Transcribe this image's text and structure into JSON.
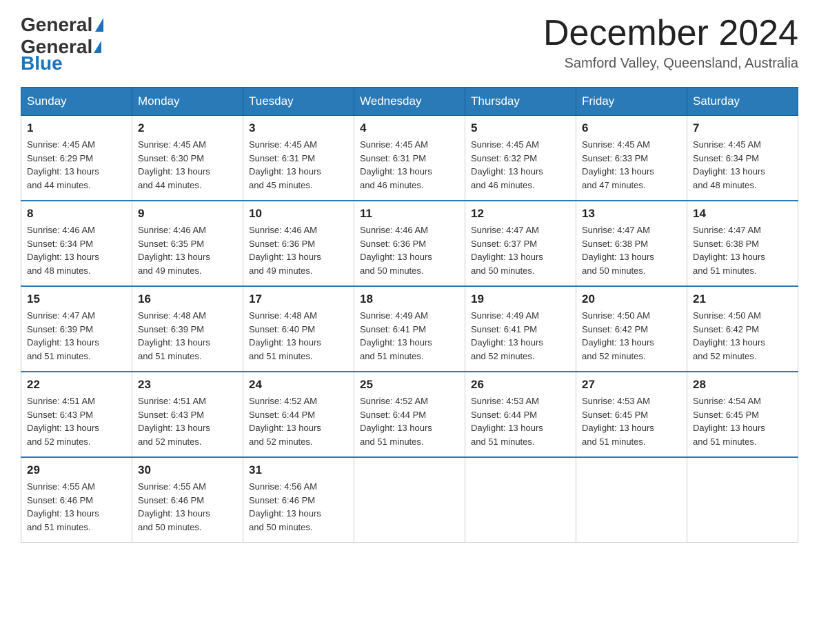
{
  "header": {
    "logo_general": "General",
    "logo_blue": "Blue",
    "month_title": "December 2024",
    "subtitle": "Samford Valley, Queensland, Australia"
  },
  "weekdays": [
    "Sunday",
    "Monday",
    "Tuesday",
    "Wednesday",
    "Thursday",
    "Friday",
    "Saturday"
  ],
  "weeks": [
    [
      {
        "day": "1",
        "sunrise": "4:45 AM",
        "sunset": "6:29 PM",
        "daylight": "13 hours and 44 minutes."
      },
      {
        "day": "2",
        "sunrise": "4:45 AM",
        "sunset": "6:30 PM",
        "daylight": "13 hours and 44 minutes."
      },
      {
        "day": "3",
        "sunrise": "4:45 AM",
        "sunset": "6:31 PM",
        "daylight": "13 hours and 45 minutes."
      },
      {
        "day": "4",
        "sunrise": "4:45 AM",
        "sunset": "6:31 PM",
        "daylight": "13 hours and 46 minutes."
      },
      {
        "day": "5",
        "sunrise": "4:45 AM",
        "sunset": "6:32 PM",
        "daylight": "13 hours and 46 minutes."
      },
      {
        "day": "6",
        "sunrise": "4:45 AM",
        "sunset": "6:33 PM",
        "daylight": "13 hours and 47 minutes."
      },
      {
        "day": "7",
        "sunrise": "4:45 AM",
        "sunset": "6:34 PM",
        "daylight": "13 hours and 48 minutes."
      }
    ],
    [
      {
        "day": "8",
        "sunrise": "4:46 AM",
        "sunset": "6:34 PM",
        "daylight": "13 hours and 48 minutes."
      },
      {
        "day": "9",
        "sunrise": "4:46 AM",
        "sunset": "6:35 PM",
        "daylight": "13 hours and 49 minutes."
      },
      {
        "day": "10",
        "sunrise": "4:46 AM",
        "sunset": "6:36 PM",
        "daylight": "13 hours and 49 minutes."
      },
      {
        "day": "11",
        "sunrise": "4:46 AM",
        "sunset": "6:36 PM",
        "daylight": "13 hours and 50 minutes."
      },
      {
        "day": "12",
        "sunrise": "4:47 AM",
        "sunset": "6:37 PM",
        "daylight": "13 hours and 50 minutes."
      },
      {
        "day": "13",
        "sunrise": "4:47 AM",
        "sunset": "6:38 PM",
        "daylight": "13 hours and 50 minutes."
      },
      {
        "day": "14",
        "sunrise": "4:47 AM",
        "sunset": "6:38 PM",
        "daylight": "13 hours and 51 minutes."
      }
    ],
    [
      {
        "day": "15",
        "sunrise": "4:47 AM",
        "sunset": "6:39 PM",
        "daylight": "13 hours and 51 minutes."
      },
      {
        "day": "16",
        "sunrise": "4:48 AM",
        "sunset": "6:39 PM",
        "daylight": "13 hours and 51 minutes."
      },
      {
        "day": "17",
        "sunrise": "4:48 AM",
        "sunset": "6:40 PM",
        "daylight": "13 hours and 51 minutes."
      },
      {
        "day": "18",
        "sunrise": "4:49 AM",
        "sunset": "6:41 PM",
        "daylight": "13 hours and 51 minutes."
      },
      {
        "day": "19",
        "sunrise": "4:49 AM",
        "sunset": "6:41 PM",
        "daylight": "13 hours and 52 minutes."
      },
      {
        "day": "20",
        "sunrise": "4:50 AM",
        "sunset": "6:42 PM",
        "daylight": "13 hours and 52 minutes."
      },
      {
        "day": "21",
        "sunrise": "4:50 AM",
        "sunset": "6:42 PM",
        "daylight": "13 hours and 52 minutes."
      }
    ],
    [
      {
        "day": "22",
        "sunrise": "4:51 AM",
        "sunset": "6:43 PM",
        "daylight": "13 hours and 52 minutes."
      },
      {
        "day": "23",
        "sunrise": "4:51 AM",
        "sunset": "6:43 PM",
        "daylight": "13 hours and 52 minutes."
      },
      {
        "day": "24",
        "sunrise": "4:52 AM",
        "sunset": "6:44 PM",
        "daylight": "13 hours and 52 minutes."
      },
      {
        "day": "25",
        "sunrise": "4:52 AM",
        "sunset": "6:44 PM",
        "daylight": "13 hours and 51 minutes."
      },
      {
        "day": "26",
        "sunrise": "4:53 AM",
        "sunset": "6:44 PM",
        "daylight": "13 hours and 51 minutes."
      },
      {
        "day": "27",
        "sunrise": "4:53 AM",
        "sunset": "6:45 PM",
        "daylight": "13 hours and 51 minutes."
      },
      {
        "day": "28",
        "sunrise": "4:54 AM",
        "sunset": "6:45 PM",
        "daylight": "13 hours and 51 minutes."
      }
    ],
    [
      {
        "day": "29",
        "sunrise": "4:55 AM",
        "sunset": "6:46 PM",
        "daylight": "13 hours and 51 minutes."
      },
      {
        "day": "30",
        "sunrise": "4:55 AM",
        "sunset": "6:46 PM",
        "daylight": "13 hours and 50 minutes."
      },
      {
        "day": "31",
        "sunrise": "4:56 AM",
        "sunset": "6:46 PM",
        "daylight": "13 hours and 50 minutes."
      },
      null,
      null,
      null,
      null
    ]
  ],
  "labels": {
    "sunrise": "Sunrise: ",
    "sunset": "Sunset: ",
    "daylight": "Daylight: "
  }
}
